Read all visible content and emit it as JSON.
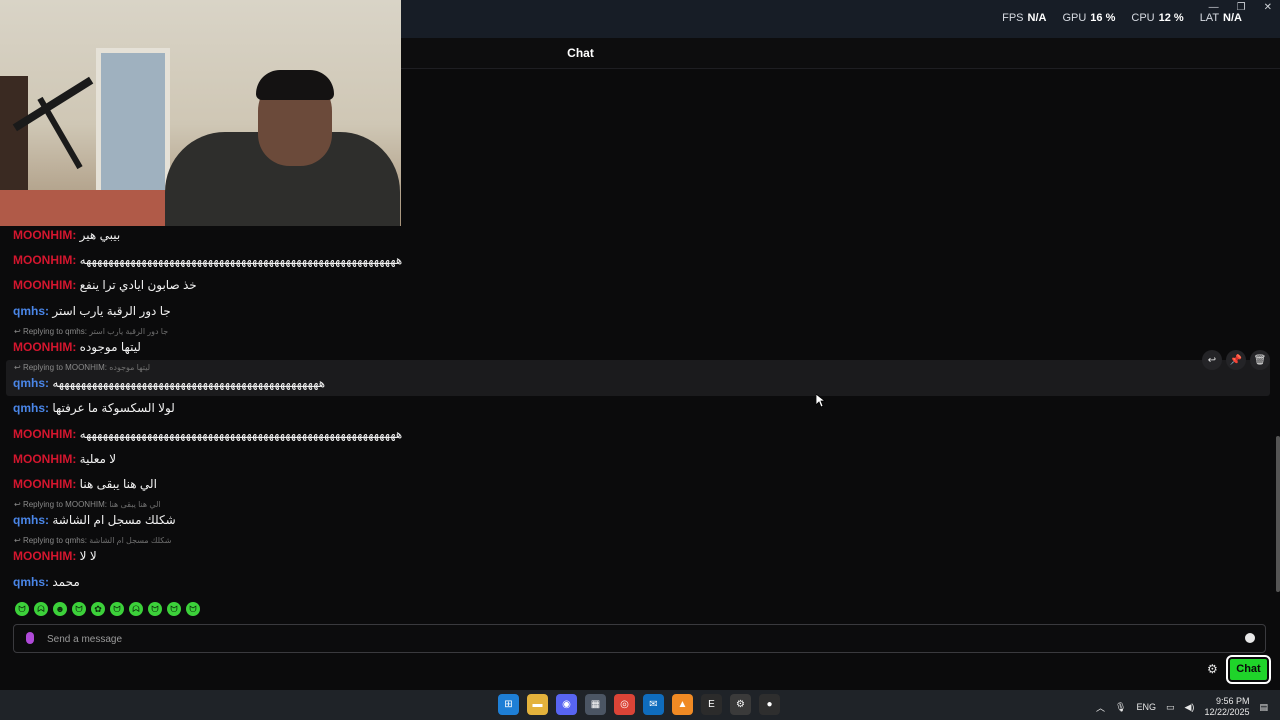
{
  "topbar": {
    "stats": [
      {
        "key": "FPS",
        "value": "N/A"
      },
      {
        "key": "GPU",
        "value": "16 %"
      },
      {
        "key": "CPU",
        "value": "12 %"
      },
      {
        "key": "LAT",
        "value": "N/A"
      }
    ],
    "window_controls": [
      "—",
      "❐",
      "✕"
    ]
  },
  "chat": {
    "title": "Chat",
    "messages": [
      {
        "user": "MOONHIM:",
        "text": "بيبي هير"
      },
      {
        "user": "MOONHIM:",
        "text": "هههههههههههههههههههههههههههههههههههههههههههههههههههههههههه"
      },
      {
        "user": "MOONHIM:",
        "text": "خذ صابون ايادي ترا ينفع"
      },
      {
        "user": "qmhs:",
        "text": "جا دور الرقبة يارب استر"
      },
      {
        "reply_to": "Replying to qmhs:",
        "reply_text": "جا دور الرقبة يارب استر",
        "user": "MOONHIM:",
        "text": "ليتها موجوده"
      },
      {
        "reply_to": "Replying to MOONHIM:",
        "reply_text": "ليتها موجوده",
        "user": "qmhs:",
        "text": "ههههههههههههههههههههههههههههههههههههههههههههههههه"
      },
      {
        "user": "qmhs:",
        "text": "لولا السكسوكة ما عرفتها"
      },
      {
        "user": "MOONHIM:",
        "text": "هههههههههههههههههههههههههههههههههههههههههههههههههههههههههه"
      },
      {
        "user": "MOONHIM:",
        "text": "لا معلية"
      },
      {
        "user": "MOONHIM:",
        "text": "الي هنا يبقى هنا"
      },
      {
        "reply_to": "Replying to MOONHIM:",
        "reply_text": "الي هنا يبقى هنا",
        "user": "qmhs:",
        "text": "شكلك مسجل ام الشاشة"
      },
      {
        "reply_to": "Replying to qmhs:",
        "reply_text": "شكلك مسجل ام الشاشة",
        "user": "MOONHIM:",
        "text": "لا لا"
      },
      {
        "user": "qmhs:",
        "text": "محمد"
      }
    ],
    "message_actions": [
      "↩",
      "📌",
      "🗑"
    ],
    "input_placeholder": "Send a message",
    "send_label": "Chat",
    "emotes": [
      "ᗢ",
      "ᗣ",
      "☻",
      "ᗢ",
      "✿",
      "ᗢ",
      "ᗣ",
      "ᗢ",
      "ᗢ",
      "ᗢ"
    ]
  },
  "taskbar": {
    "apps": [
      "windows-start",
      "file-explorer",
      "discord",
      "store",
      "chrome",
      "mail",
      "vlc",
      "epic-games",
      "steelseries",
      "obs"
    ],
    "tray_lang": "ENG",
    "time": "9:56 PM",
    "date": "12/22/2025"
  },
  "colors": {
    "moonhim": "#d4162e",
    "qmhs": "#4a86e8",
    "accent_green": "#1fd42a"
  }
}
